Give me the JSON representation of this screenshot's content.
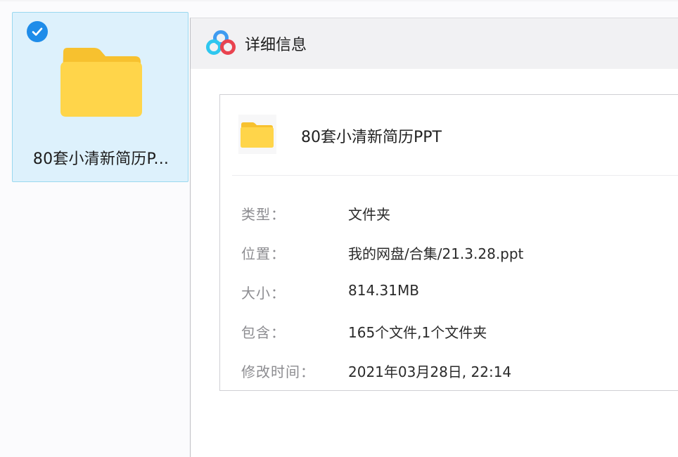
{
  "selected_item": {
    "name": "80套小清新简历P...",
    "selected": true
  },
  "details": {
    "title": "详细信息",
    "file_name": "80套小清新简历PPT",
    "rows": [
      {
        "label": "类型：",
        "value": "文件夹"
      },
      {
        "label": "位置：",
        "value": "我的网盘/合集/21.3.28.ppt"
      },
      {
        "label": "大小：",
        "value": "814.31MB"
      },
      {
        "label": "包含：",
        "value": "165个文件,1个文件夹"
      },
      {
        "label": "修改时间：",
        "value": "2021年03月28日, 22:14"
      }
    ]
  },
  "colors": {
    "selection_bg": "#ddf1fc",
    "selection_border": "#9ad8ef",
    "check_blue": "#1e8ce9",
    "folder_yellow": "#ffd54a"
  }
}
